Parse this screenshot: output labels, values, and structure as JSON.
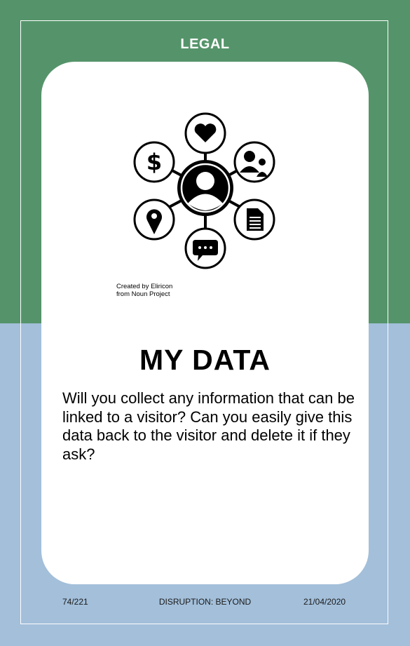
{
  "colors": {
    "top_band": "#55946A",
    "bottom_band": "#A3BFDA",
    "card": "#FFFFFF"
  },
  "header": {
    "category": "LEGAL"
  },
  "illustration": {
    "icons": [
      "user-icon",
      "heart-icon",
      "people-icon",
      "document-icon",
      "chat-icon",
      "location-pin-icon",
      "dollar-icon"
    ],
    "credit_line1": "Created by Eliricon",
    "credit_line2": "from Noun Project"
  },
  "card": {
    "title": "MY DATA",
    "question": "Will you collect any information that can be linked to a visitor? Can you easily give this data back to the visitor and delete it if they ask?"
  },
  "footer": {
    "page": "74/221",
    "deck": "DISRUPTION: BEYOND",
    "date": "21/04/2020"
  }
}
